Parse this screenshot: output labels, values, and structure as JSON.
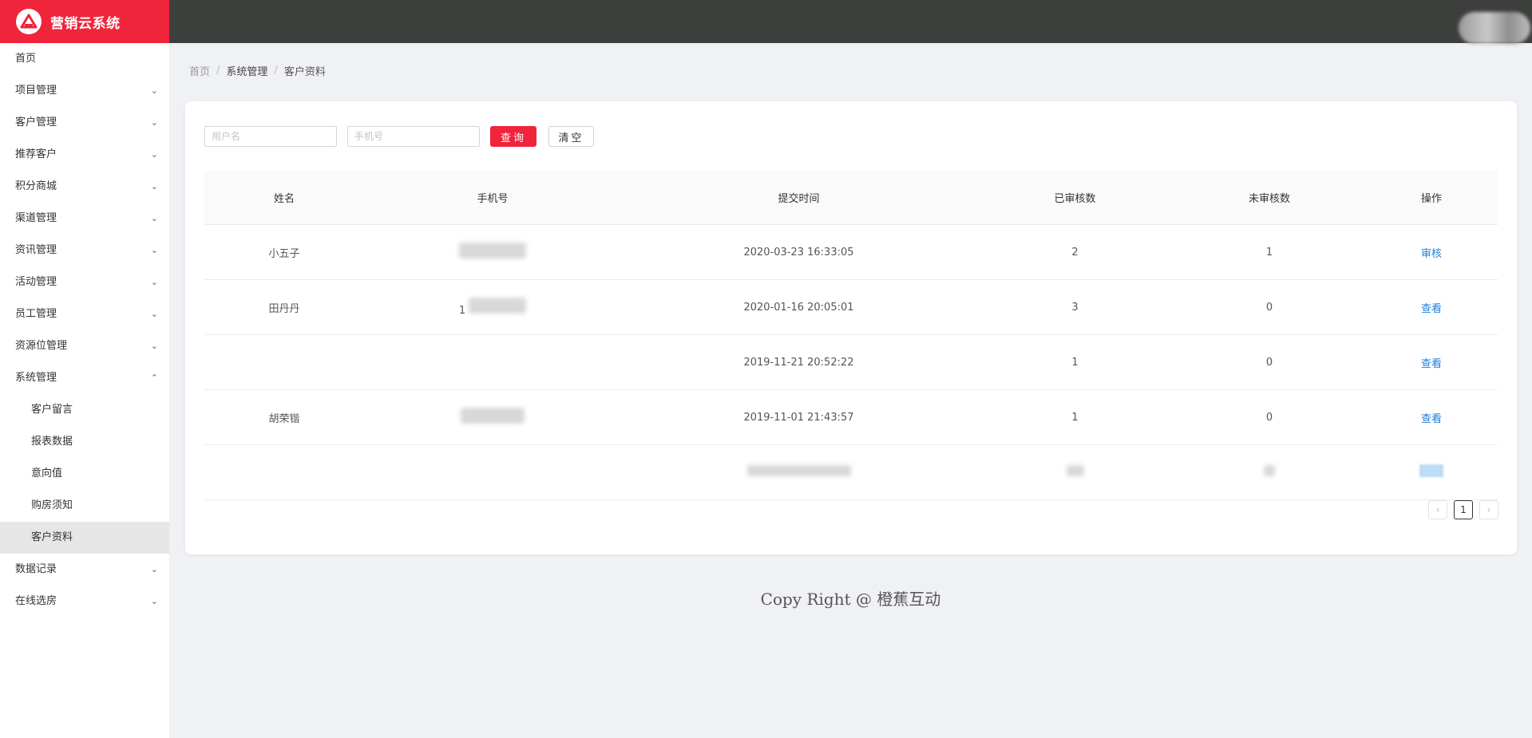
{
  "app": {
    "title": "营销云系统"
  },
  "sidebar": {
    "items": [
      {
        "label": "首页",
        "has_children": false,
        "expanded": false
      },
      {
        "label": "项目管理",
        "has_children": true,
        "expanded": false
      },
      {
        "label": "客户管理",
        "has_children": true,
        "expanded": false
      },
      {
        "label": "推荐客户",
        "has_children": true,
        "expanded": false
      },
      {
        "label": "积分商城",
        "has_children": true,
        "expanded": false
      },
      {
        "label": "渠道管理",
        "has_children": true,
        "expanded": false
      },
      {
        "label": "资讯管理",
        "has_children": true,
        "expanded": false
      },
      {
        "label": "活动管理",
        "has_children": true,
        "expanded": false
      },
      {
        "label": "员工管理",
        "has_children": true,
        "expanded": false
      },
      {
        "label": "资源位管理",
        "has_children": true,
        "expanded": false
      },
      {
        "label": "系统管理",
        "has_children": true,
        "expanded": true,
        "children": [
          "客户留言",
          "报表数据",
          "意向值",
          "购房须知",
          "客户资料"
        ],
        "active_child": "客户资料"
      },
      {
        "label": "数据记录",
        "has_children": true,
        "expanded": false
      },
      {
        "label": "在线选房",
        "has_children": true,
        "expanded": false
      }
    ]
  },
  "breadcrumb": [
    "首页",
    "系统管理",
    "客户资料"
  ],
  "filters": {
    "username_placeholder": "用户名",
    "phone_placeholder": "手机号",
    "query_label": "查询",
    "clear_label": "清空"
  },
  "table": {
    "columns": [
      "姓名",
      "手机号",
      "提交时间",
      "已审核数",
      "未审核数",
      "操作"
    ],
    "rows": [
      {
        "name": "小五子",
        "phone": "",
        "submitted": "2020-03-23 16:33:05",
        "reviewed": "2",
        "pending": "1",
        "action": "审核"
      },
      {
        "name": "田丹丹",
        "phone": "1",
        "submitted": "2020-01-16 20:05:01",
        "reviewed": "3",
        "pending": "0",
        "action": "查看"
      },
      {
        "name": "",
        "phone": "",
        "submitted": "2019-11-21 20:52:22",
        "reviewed": "1",
        "pending": "0",
        "action": "查看"
      },
      {
        "name": "胡荣锴",
        "phone": "",
        "submitted": "2019-11-01 21:43:57",
        "reviewed": "1",
        "pending": "0",
        "action": "查看"
      },
      {
        "name": "",
        "phone": "",
        "submitted": "",
        "reviewed": "",
        "pending": "",
        "action": ""
      }
    ]
  },
  "pagination": {
    "current_page": "1",
    "prev_icon": "chevron-left",
    "next_icon": "chevron-right"
  },
  "footer": {
    "text": "Copy Right @ 橙蕉互动"
  },
  "colors": {
    "brand": "#f0243a",
    "header": "#3d3f3d",
    "link": "#1f7fdc",
    "background": "#f0f1f5"
  }
}
